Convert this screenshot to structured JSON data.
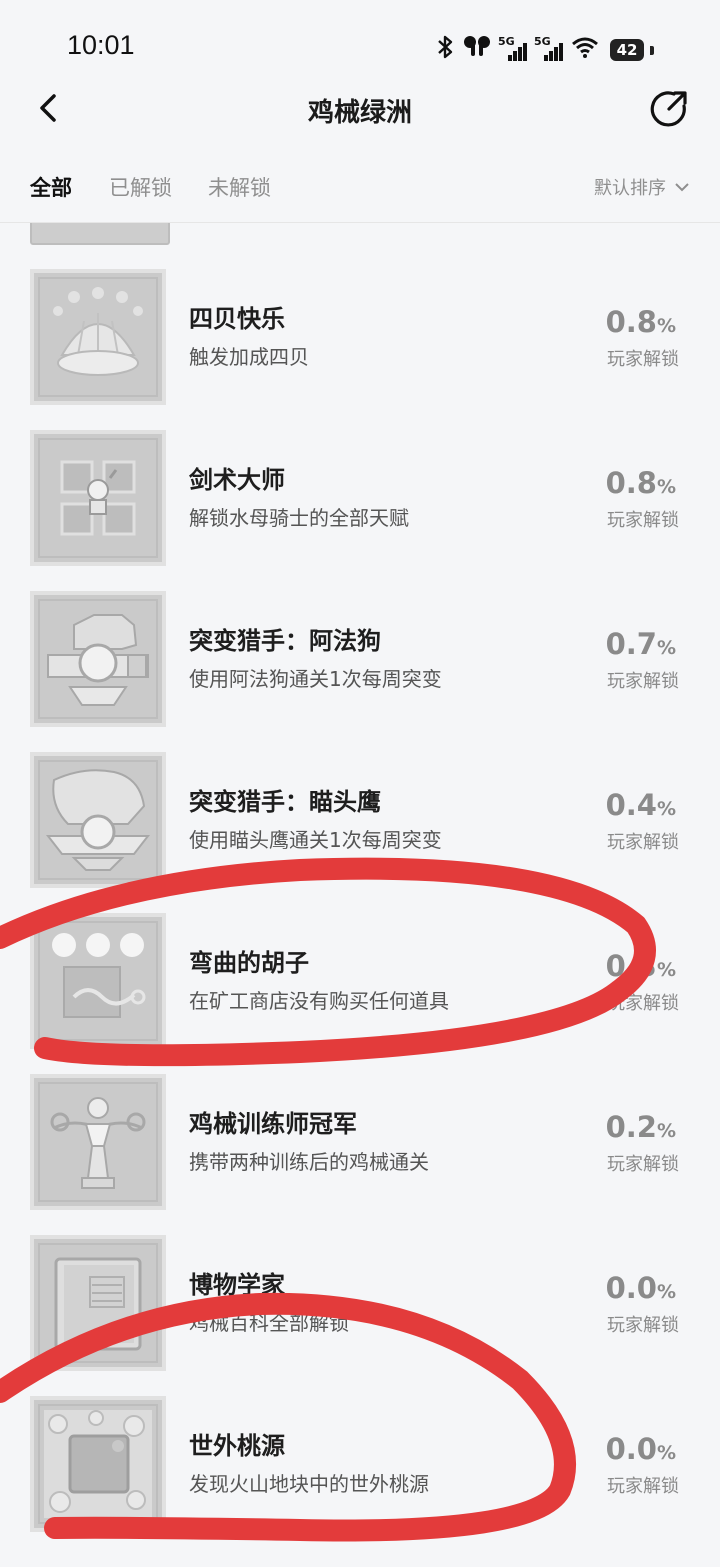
{
  "status_bar": {
    "time": "10:01",
    "network_1": "5G",
    "network_2": "5G",
    "battery": "42",
    "icons": [
      "bluetooth-icon",
      "earbuds-icon",
      "signal-icon",
      "signal-icon",
      "wifi-icon",
      "battery-icon"
    ]
  },
  "header": {
    "title": "鸡械绿洲",
    "back_icon": "back-arrow-icon",
    "share_icon": "share-icon"
  },
  "tabs": [
    {
      "label": "全部",
      "active": true
    },
    {
      "label": "已解锁",
      "active": false
    },
    {
      "label": "未解锁",
      "active": false
    }
  ],
  "sort": {
    "label": "默认排序",
    "icon": "chevron-down-icon"
  },
  "achievements": [
    {
      "name": "四贝快乐",
      "desc": "触发加成四贝",
      "percent": "0.8",
      "unit": "%",
      "unlock_label": "玩家解锁"
    },
    {
      "name": "剑术大师",
      "desc": "解锁水母骑士的全部天赋",
      "percent": "0.8",
      "unit": "%",
      "unlock_label": "玩家解锁"
    },
    {
      "name": "突变猎手：阿法狗",
      "desc": "使用阿法狗通关1次每周突变",
      "percent": "0.7",
      "unit": "%",
      "unlock_label": "玩家解锁"
    },
    {
      "name": "突变猎手：瞄头鹰",
      "desc": "使用瞄头鹰通关1次每周突变",
      "percent": "0.4",
      "unit": "%",
      "unlock_label": "玩家解锁"
    },
    {
      "name": "弯曲的胡子",
      "desc": "在矿工商店没有购买任何道具",
      "percent": "0.3",
      "unit": "%",
      "unlock_label": "玩家解锁"
    },
    {
      "name": "鸡械训练师冠军",
      "desc": "携带两种训练后的鸡械通关",
      "percent": "0.2",
      "unit": "%",
      "unlock_label": "玩家解锁"
    },
    {
      "name": "博物学家",
      "desc": "鸡械百科全部解锁",
      "percent": "0.0",
      "unit": "%",
      "unlock_label": "玩家解锁"
    },
    {
      "name": "世外桃源",
      "desc": "发现火山地块中的世外桃源",
      "percent": "0.0",
      "unit": "%",
      "unlock_label": "玩家解锁"
    }
  ],
  "colors": {
    "annotation_red": "#e33b3b",
    "thumb_gray": "#cacaca",
    "text_muted": "#8a8a8a"
  }
}
